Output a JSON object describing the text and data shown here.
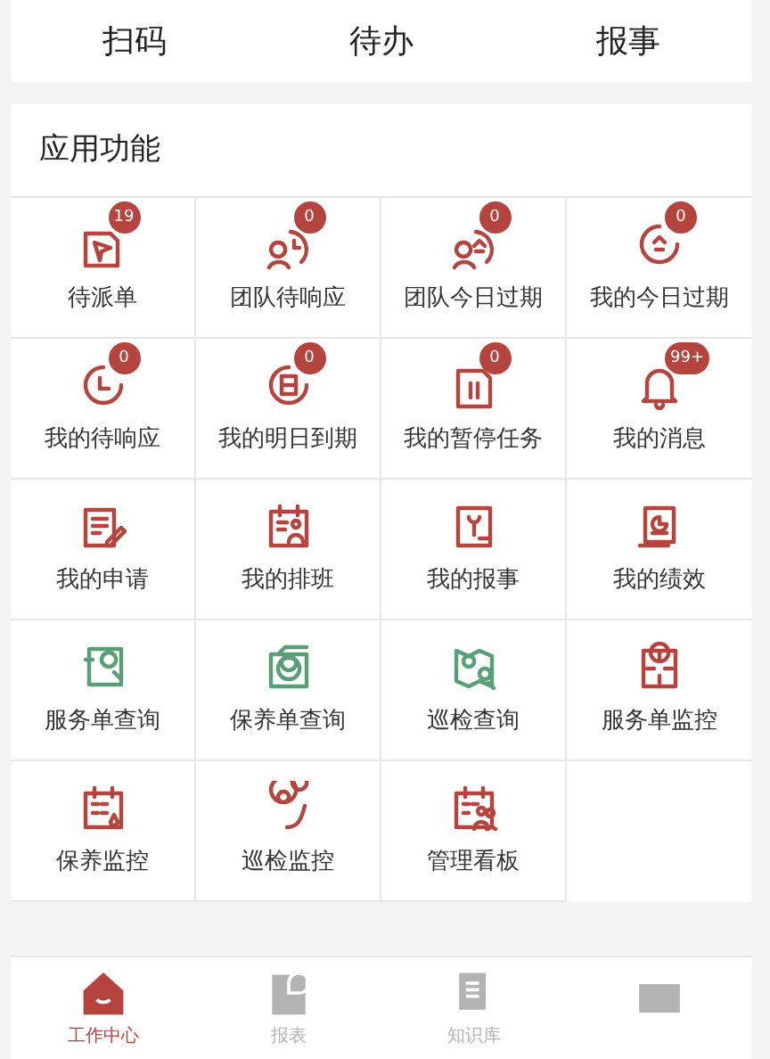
{
  "quick_actions": [
    {
      "label": "扫码"
    },
    {
      "label": "待办"
    },
    {
      "label": "报事"
    }
  ],
  "section_title": "应用功能",
  "functions": [
    {
      "label": "待派单",
      "badge": "19",
      "color": "#b5433e"
    },
    {
      "label": "团队待响应",
      "badge": "0",
      "color": "#b5433e"
    },
    {
      "label": "团队今日过期",
      "badge": "0",
      "color": "#b5433e"
    },
    {
      "label": "我的今日过期",
      "badge": "0",
      "color": "#b5433e"
    },
    {
      "label": "我的待响应",
      "badge": "0",
      "color": "#b5433e"
    },
    {
      "label": "我的明日到期",
      "badge": "0",
      "color": "#b5433e"
    },
    {
      "label": "我的暂停任务",
      "badge": "0",
      "color": "#b5433e"
    },
    {
      "label": "我的消息",
      "badge": "99+",
      "color": "#b5433e"
    },
    {
      "label": "我的申请",
      "color": "#b5433e"
    },
    {
      "label": "我的排班",
      "color": "#b5433e"
    },
    {
      "label": "我的报事",
      "color": "#b5433e"
    },
    {
      "label": "我的绩效",
      "color": "#b5433e"
    },
    {
      "label": "服务单查询",
      "color": "#5a9e78"
    },
    {
      "label": "保养单查询",
      "color": "#5a9e78"
    },
    {
      "label": "巡检查询",
      "color": "#5a9e78"
    },
    {
      "label": "服务单监控",
      "color": "#b5433e"
    },
    {
      "label": "保养监控",
      "color": "#b5433e"
    },
    {
      "label": "巡检监控",
      "color": "#b5433e"
    },
    {
      "label": "管理看板",
      "color": "#b5433e"
    }
  ],
  "tab_bar": [
    {
      "label": "工作中心",
      "selected": true
    },
    {
      "label": "报表",
      "selected": false
    },
    {
      "label": "知识库",
      "selected": false
    },
    {
      "selected": false
    }
  ]
}
